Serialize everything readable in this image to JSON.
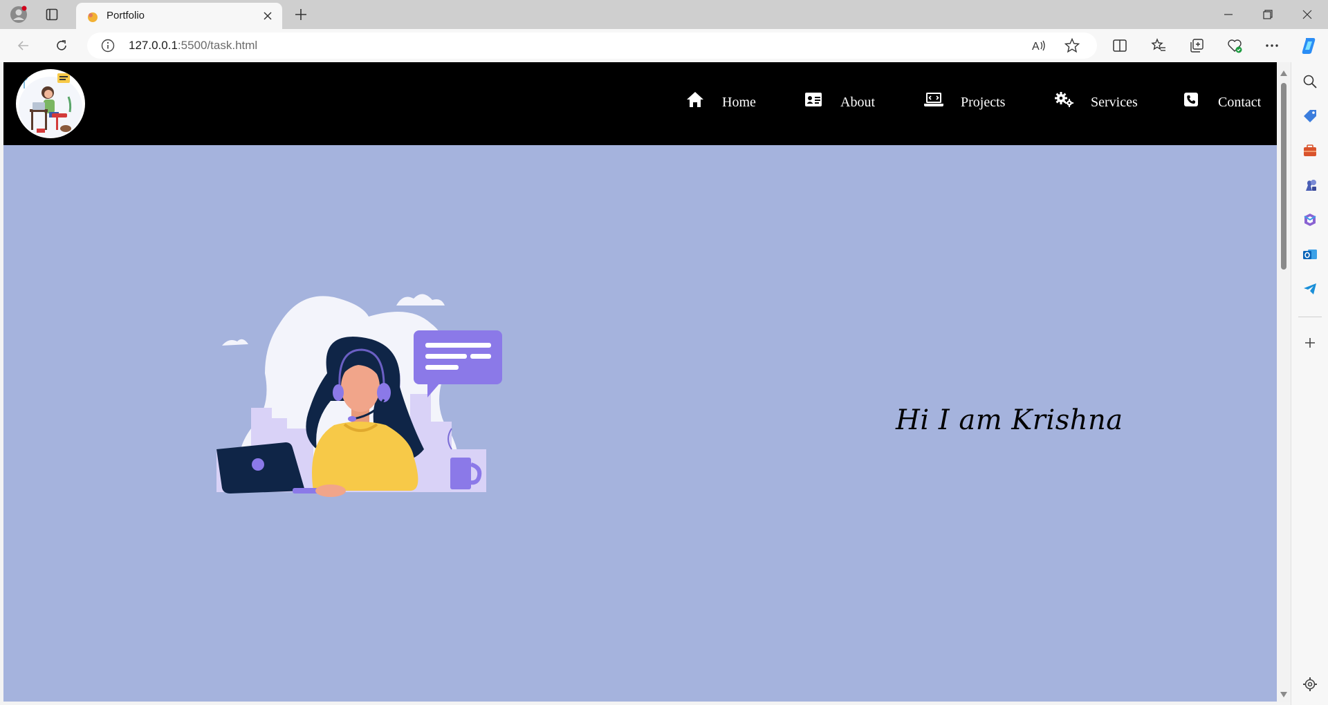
{
  "browser": {
    "tab_title": "Portfolio",
    "url_host": "127.0.0.1",
    "url_path": ":5500/task.html"
  },
  "nav": {
    "items": [
      {
        "label": "Home",
        "icon": "home-icon"
      },
      {
        "label": "About",
        "icon": "id-card-icon"
      },
      {
        "label": "Projects",
        "icon": "laptop-code-icon"
      },
      {
        "label": "Services",
        "icon": "cogs-icon"
      },
      {
        "label": "Contact",
        "icon": "phone-icon"
      }
    ]
  },
  "hero": {
    "heading": "Hi I am Krishna"
  },
  "colors": {
    "page_bg": "#a5b3dd",
    "nav_bg": "#000000",
    "nav_text": "#ffffff",
    "accent_purple": "#8b79e8",
    "illustration_yellow": "#f7c948",
    "illustration_navy": "#0f2547"
  }
}
